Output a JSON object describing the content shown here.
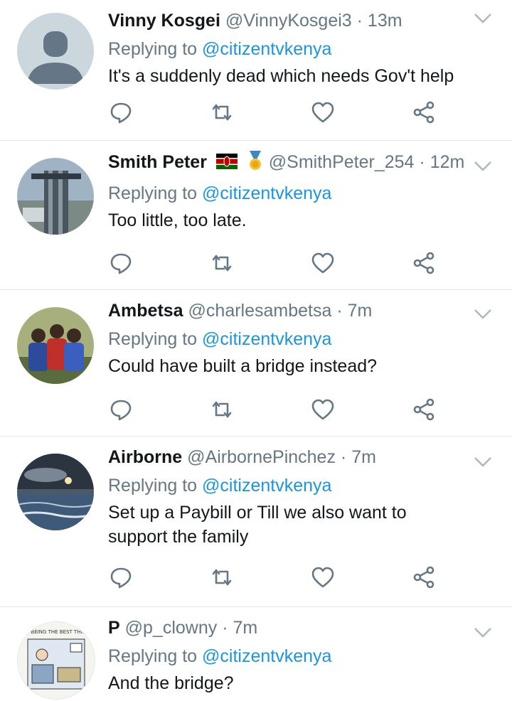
{
  "tweets": [
    {
      "name": "Vinny Kosgei",
      "handle": "@VinnyKosgei3",
      "time": "13m",
      "replying_label": "Replying to",
      "replying_to": "@citizentvkenya",
      "text": "It's a suddenly dead which needs Gov't help"
    },
    {
      "name": "Smith Peter",
      "handle": "@SmithPeter_254",
      "time": "12m",
      "replying_label": "Replying to",
      "replying_to": "@citizentvkenya",
      "text": "Too little, too late."
    },
    {
      "name": "Ambetsa",
      "handle": "@charlesambetsa",
      "time": "7m",
      "replying_label": "Replying to",
      "replying_to": "@citizentvkenya",
      "text": "Could have built a bridge instead?"
    },
    {
      "name": "Airborne",
      "handle": "@AirbornePinchez",
      "time": "7m",
      "replying_label": "Replying to",
      "replying_to": "@citizentvkenya",
      "text": "Set up a Paybill or Till we also want to support the family"
    },
    {
      "name": "P",
      "handle": "@p_clowny",
      "time": "7m",
      "replying_label": "Replying to",
      "replying_to": "@citizentvkenya",
      "text": "And the bridge?"
    }
  ],
  "separator": "·",
  "avatar_text": "THIS BEING THE BEST THING...",
  "colors": {
    "link": "#1b95e0",
    "secondary": "#657786",
    "icon": "#657786",
    "border": "#e1e8ed"
  },
  "icons": [
    "reply-icon",
    "retweet-icon",
    "like-icon",
    "share-icon",
    "chevron-down-icon",
    "kenya-flag-icon",
    "medal-icon"
  ]
}
